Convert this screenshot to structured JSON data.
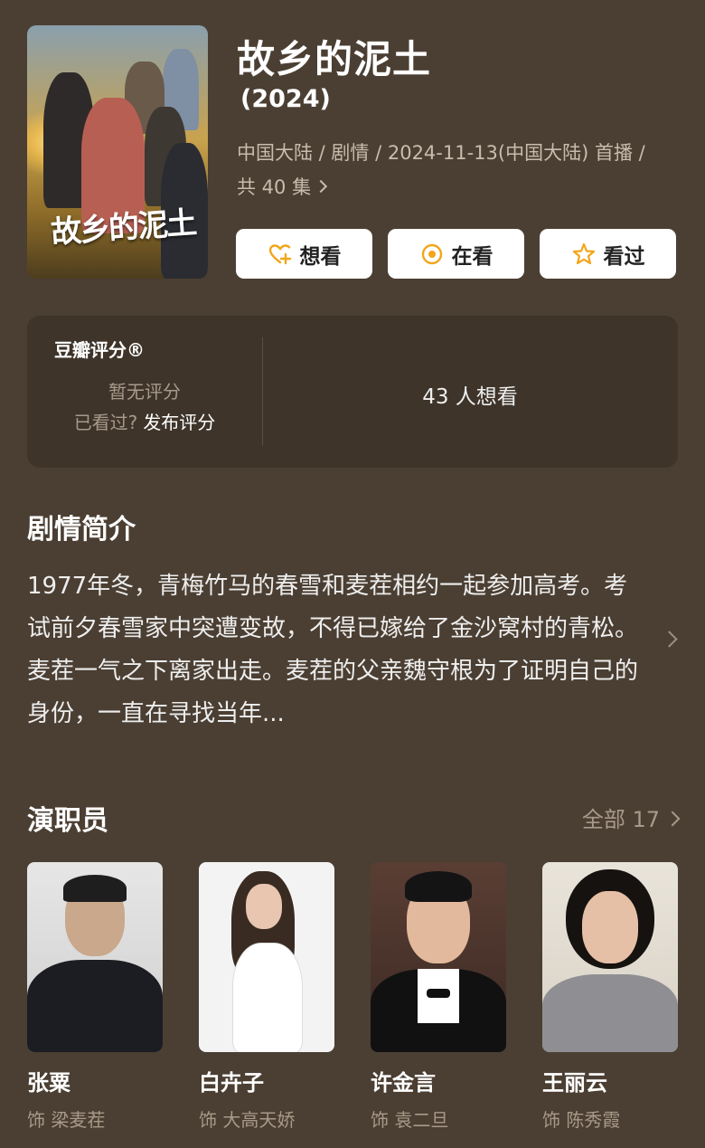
{
  "show": {
    "title": "故乡的泥土",
    "year": "(2024)",
    "meta_line1": "中国大陆 / 剧情 / 2024-11-13(中国大陆) 首播 /",
    "meta_line2": "共 40 集",
    "poster_text": "故乡的泥土"
  },
  "actions": [
    {
      "label": "想看",
      "icon": "heart-plus-icon"
    },
    {
      "label": "在看",
      "icon": "target-circle-icon"
    },
    {
      "label": "看过",
      "icon": "star-icon"
    }
  ],
  "rating": {
    "title": "豆瓣评分®",
    "no_rating": "暂无评分",
    "watched_prompt": "已看过?",
    "publish_link": "发布评分",
    "want_count": "43 人想看"
  },
  "synopsis": {
    "heading": "剧情简介",
    "text": "1977年冬，青梅竹马的春雪和麦茬相约一起参加高考。考试前夕春雪家中突遭变故，不得已嫁给了金沙窝村的青松。麦茬一气之下离家出走。麦茬的父亲魏守根为了证明自己的身份，一直在寻找当年..."
  },
  "cast_section": {
    "heading": "演职员",
    "all_label": "全部 17",
    "members": [
      {
        "name": "张粟",
        "role": "饰 梁麦茬"
      },
      {
        "name": "白卉子",
        "role": "饰 大高天娇"
      },
      {
        "name": "许金言",
        "role": "饰 袁二旦"
      },
      {
        "name": "王丽云",
        "role": "饰 陈秀霞"
      }
    ]
  },
  "colors": {
    "background": "#4b3f33",
    "card": "#3e342a",
    "accent": "#f2a51b"
  }
}
